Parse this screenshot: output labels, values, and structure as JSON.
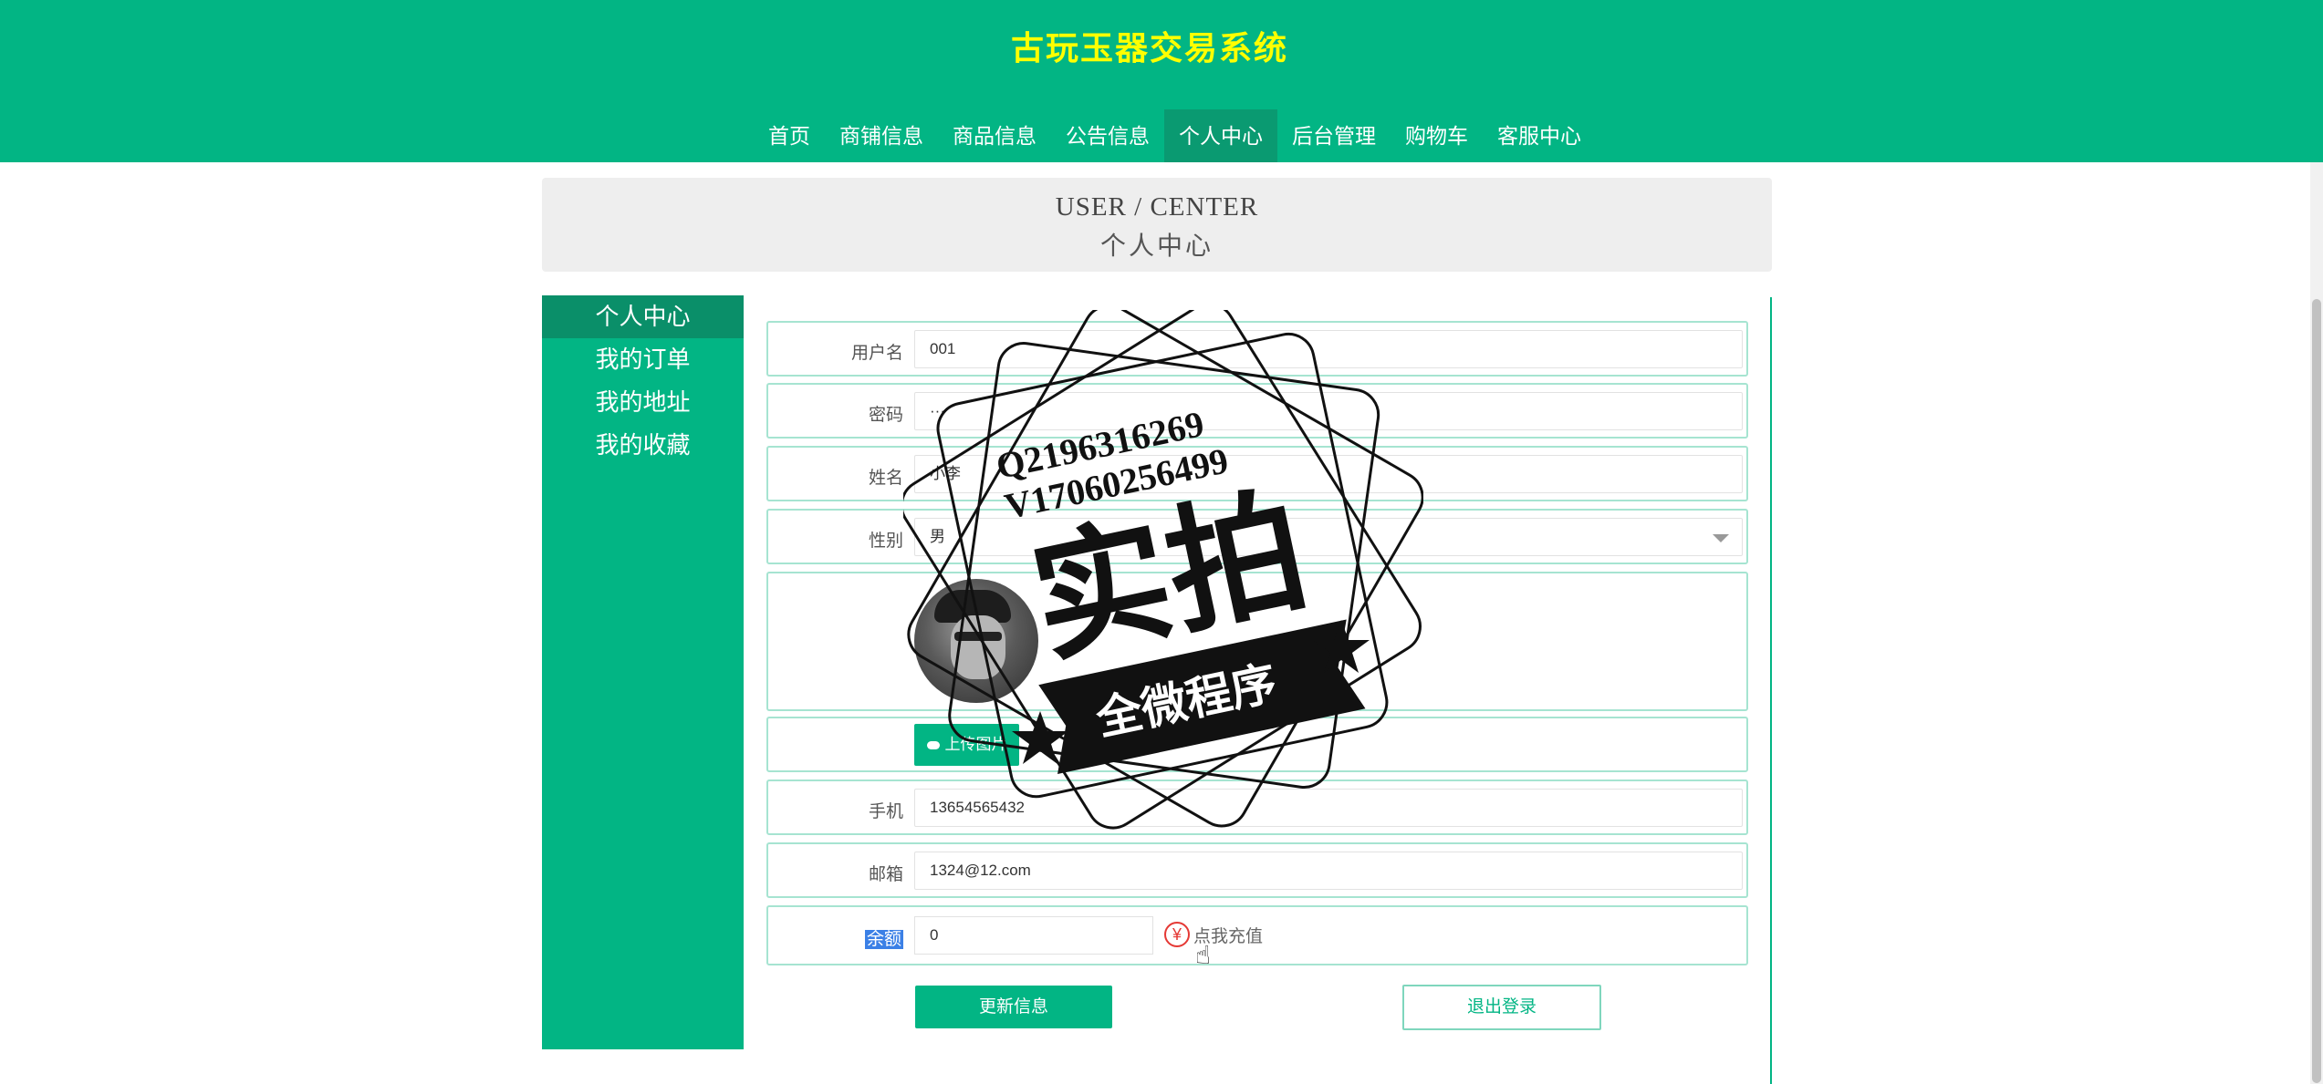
{
  "site": {
    "title": "古玩玉器交易系统"
  },
  "nav": {
    "items": [
      "首页",
      "商铺信息",
      "商品信息",
      "公告信息",
      "个人中心",
      "后台管理",
      "购物车",
      "客服中心"
    ],
    "active_index": 4
  },
  "banner": {
    "en": "USER / CENTER",
    "cn": "个人中心"
  },
  "sidebar": {
    "items": [
      "个人中心",
      "我的订单",
      "我的地址",
      "我的收藏"
    ],
    "active_index": 0
  },
  "form": {
    "username_label": "用户名",
    "username_value": "001",
    "password_label": "密码",
    "password_value": "···",
    "name_label": "姓名",
    "name_value": "小李",
    "gender_label": "性别",
    "gender_value": "男",
    "upload_label": "上传图片",
    "phone_label": "手机",
    "phone_value": "13654565432",
    "email_label": "邮箱",
    "email_value": "1324@12.com",
    "balance_label": "余额",
    "balance_value": "0",
    "recharge_label": "点我充值"
  },
  "actions": {
    "update_label": "更新信息",
    "logout_label": "退出登录"
  },
  "watermark": {
    "line1": "Q2196316269",
    "line2": "V17060256499",
    "big": "实拍",
    "banner": "全微程序"
  },
  "colors": {
    "primary": "#02b584",
    "title": "#ffff00",
    "highlight": "#3b80e6",
    "recharge_icon": "#e53935"
  },
  "icons": {
    "recharge": "yen-icon",
    "upload": "cloud-upload-icon",
    "select": "chevron-down-icon",
    "cursor": "hand-cursor-icon"
  }
}
